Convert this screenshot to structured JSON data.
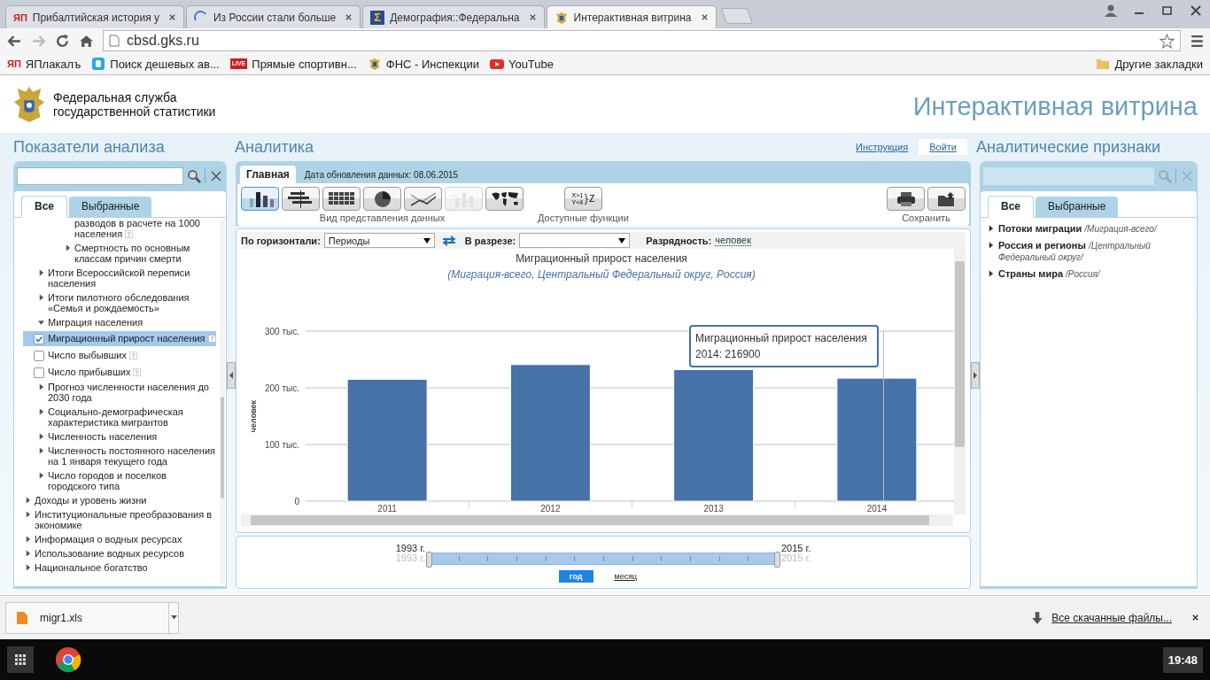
{
  "browser": {
    "tabs": [
      {
        "title": "Прибалтийская история у",
        "kind": "yap",
        "icon_text": "ЯП",
        "selected": false
      },
      {
        "title": "Из России стали больше",
        "kind": "spinner",
        "selected": false
      },
      {
        "title": "Демография::Федеральна",
        "kind": "sigma",
        "icon_text": "Σ",
        "selected": false
      },
      {
        "title": "Интерактивная витрина",
        "kind": "emblem",
        "selected": true
      }
    ],
    "address": "cbsd.gks.ru",
    "bookmarks": [
      {
        "label": "ЯПлакалъ",
        "kind": "yap",
        "icon_text": "ЯП"
      },
      {
        "label": "Поиск дешевых ав...",
        "kind": "plane"
      },
      {
        "label": "Прямые спортивн...",
        "kind": "live",
        "icon_text": "LIVE"
      },
      {
        "label": "ФНС - Инспекции",
        "kind": "emblem"
      },
      {
        "label": "YouTube",
        "kind": "youtube"
      }
    ],
    "other_bookmarks": "Другие закладки"
  },
  "site": {
    "agency": [
      "Федеральная служба",
      "государственной статистики"
    ],
    "title": "Интерактивная витрина"
  },
  "left": {
    "heading": "Показатели анализа",
    "tabs": [
      {
        "label": "Все",
        "selected": true
      },
      {
        "label": "Выбранные",
        "selected": false
      }
    ],
    "tree": [
      {
        "kind": "hidden",
        "children": [
          {
            "kind": "hidden",
            "children": [
              {
                "kind": "hidden",
                "children": [
                  {
                    "kind": "hidden",
                    "children": [
                      {
                        "kind": "text",
                        "label": "разводов в расчете на 1000 населения",
                        "info": true
                      }
                    ]
                  },
                  {
                    "kind": "branch",
                    "label": "Смертность по основным классам причин смерти",
                    "expanded": false
                  }
                ]
              }
            ]
          },
          {
            "kind": "branch",
            "label": "Итоги Всероссийской переписи населения",
            "expanded": false
          },
          {
            "kind": "branch",
            "label": "Итоги пилотного обследования «Семья и рождаемость»",
            "expanded": false
          },
          {
            "kind": "branch",
            "label": "Миграция населения",
            "expanded": true,
            "children": [
              {
                "kind": "check",
                "label": "Миграционный прирост населения",
                "checked": true,
                "selected": true,
                "info": true
              },
              {
                "kind": "check",
                "label": "Число выбывших",
                "checked": false,
                "selected": false,
                "info": true
              },
              {
                "kind": "check",
                "label": "Число прибывших",
                "checked": false,
                "selected": false,
                "info": true
              }
            ]
          },
          {
            "kind": "branch",
            "label": "Прогноз численности населения до 2030 года",
            "expanded": false
          },
          {
            "kind": "branch",
            "label": "Социально-демографическая характеристика мигрантов",
            "expanded": false
          },
          {
            "kind": "branch",
            "label": "Численность населения",
            "expanded": false
          },
          {
            "kind": "branch",
            "label": "Численность постоянного населения на 1 января текущего года",
            "expanded": false
          },
          {
            "kind": "branch",
            "label": "Число городов и поселков городского типа",
            "expanded": false
          }
        ]
      },
      {
        "kind": "branch",
        "label": "Доходы и уровень жизни",
        "expanded": false
      },
      {
        "kind": "branch",
        "label": "Институциональные преобразования в экономике",
        "expanded": false
      },
      {
        "kind": "branch",
        "label": "Информация о водных ресурсах",
        "expanded": false
      },
      {
        "kind": "branch",
        "label": "Использование водных ресурсов",
        "expanded": false
      },
      {
        "kind": "branch",
        "label": "Национальное богатство",
        "expanded": false
      }
    ]
  },
  "center": {
    "heading": "Аналитика",
    "links": [
      "Инструкция",
      "Войти"
    ],
    "tab": "Главная",
    "updated": "Дата обновления данных: 08.06.2015",
    "views": [
      {
        "kind": "bar",
        "selected": true,
        "disabled": false
      },
      {
        "kind": "pyramid",
        "selected": false,
        "disabled": false
      },
      {
        "kind": "table",
        "selected": false,
        "disabled": false
      },
      {
        "kind": "pie",
        "selected": false,
        "disabled": false
      },
      {
        "kind": "line",
        "selected": false,
        "disabled": false
      },
      {
        "kind": "combo",
        "selected": false,
        "disabled": true
      },
      {
        "kind": "map",
        "selected": false,
        "disabled": false
      }
    ],
    "views_label": "Вид представления данных",
    "formula": [
      "X>1",
      "Y<4",
      "Z"
    ],
    "functions_label": "Доступные функции",
    "save_label": "Сохранить",
    "horizontal_label": "По горизонтали:",
    "horizontal_value": "Периоды",
    "slice_label": "В разрезе:",
    "digits_label": "Разрядность:",
    "digits_value": "человек",
    "subtitle": "(Миграция-всего, Центральный Федеральный округ, Россия)",
    "chart_data": {
      "type": "bar",
      "title": "Миграционный прирост населения",
      "ylabel": "человек",
      "categories": [
        "2011",
        "2012",
        "2013",
        "2014"
      ],
      "values": [
        215,
        241,
        232,
        217
      ],
      "ylim": [
        0,
        300
      ],
      "yticks": [
        {
          "value": 0,
          "label": "0"
        },
        {
          "value": 100,
          "label": "100 тыс."
        },
        {
          "value": 200,
          "label": "200 тыс."
        },
        {
          "value": 300,
          "label": "300 тыс."
        }
      ]
    },
    "tooltip": {
      "title": "Миграционный прирост населения",
      "value": "2014: 216900"
    },
    "period": {
      "level": 1,
      "from": "1993 г.",
      "to": "2015 г.",
      "from_min": "1993 г.",
      "to_max": "2015 г.",
      "modes": [
        {
          "label": "год",
          "selected": true
        },
        {
          "label": "месяц",
          "selected": false
        }
      ]
    }
  },
  "right": {
    "heading": "Аналитические признаки",
    "tabs": [
      {
        "label": "Все",
        "selected": true
      },
      {
        "label": "Выбранные",
        "selected": false
      }
    ],
    "items": [
      {
        "label": "Потоки миграции",
        "note": "/Миграция-всего/"
      },
      {
        "label": "Россия и регионы",
        "note": "/Центральный Федеральный округ/"
      },
      {
        "label": "Страны мира",
        "note": "/Россия/"
      }
    ]
  },
  "downloads": {
    "file": "migr1.xls",
    "all": "Все скачанные файлы..."
  },
  "taskbar": {
    "time": "19:48"
  }
}
